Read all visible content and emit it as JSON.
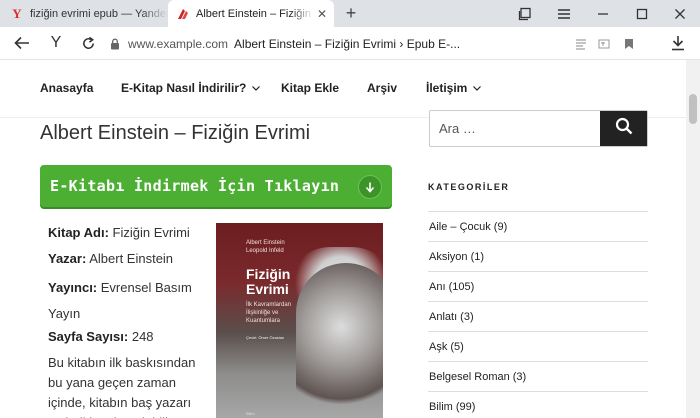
{
  "browser": {
    "tabs": [
      {
        "title": "fiziğin evrimi epub — Yandex",
        "active": false
      },
      {
        "title": "Albert Einstein – Fiziğin Evrimi",
        "active": true
      }
    ],
    "new_tab": "+",
    "url_host": "www.example.com",
    "url_title": "Albert Einstein – Fiziğin Evrimi › Epub E-...",
    "icons": [
      "back-icon",
      "yandex-icon",
      "reload-icon",
      "lock-icon",
      "reader-icon",
      "translate-icon",
      "bookmark-icon",
      "download-icon",
      "tabs-icon",
      "menu-icon",
      "minimize-icon",
      "maximize-icon",
      "close-icon"
    ]
  },
  "nav": {
    "items": [
      {
        "label": "Anasayfa"
      },
      {
        "label": "E-Kitap Nasıl İndirilir?"
      },
      {
        "label": "Kitap Ekle"
      },
      {
        "label": "Arşiv"
      },
      {
        "label": "İletişim"
      }
    ]
  },
  "post": {
    "title": "Albert Einstein – Fiziğin Evrimi",
    "download_label": "E-Kitabı İndirmek İçin Tıklayın",
    "fields": [
      {
        "label": "Kitap Adı:",
        "value": "Fiziğin Evrimi"
      },
      {
        "label": "Yazar:",
        "value": "Albert Einstein"
      },
      {
        "label": "Yayıncı:",
        "value": "Evrensel Basım Yayın"
      },
      {
        "label": "Sayfa Sayısı:",
        "value": "248"
      }
    ],
    "description": "Bu kitabın ilk baskısından bu yana geçen zaman içinde, kitabın baş yazarı ve belki en büyük bilim",
    "cover": {
      "authors": "Albert Einstein\nLeopold Infeld",
      "title": "Fiziğin\nEvrimi",
      "subtitle": "İlk Kavramlardan\nİlişkinliğe ve\nKuantumlara",
      "translator": "Çeviri: Ömer Özaslan",
      "publisher": "Bilim"
    }
  },
  "sidebar": {
    "search_placeholder": "Ara …",
    "categories_title": "KATEGORİLER",
    "categories": [
      {
        "label": "Aile – Çocuk (9)"
      },
      {
        "label": "Aksiyon (1)"
      },
      {
        "label": "Anı (105)"
      },
      {
        "label": "Anlatı (3)"
      },
      {
        "label": "Aşk (5)"
      },
      {
        "label": "Belgesel Roman (3)"
      },
      {
        "label": "Bilim (99)"
      }
    ]
  },
  "colors": {
    "accent_green": "#4caf33",
    "tab_bar": "#dee1e6",
    "search_button": "#222222"
  }
}
